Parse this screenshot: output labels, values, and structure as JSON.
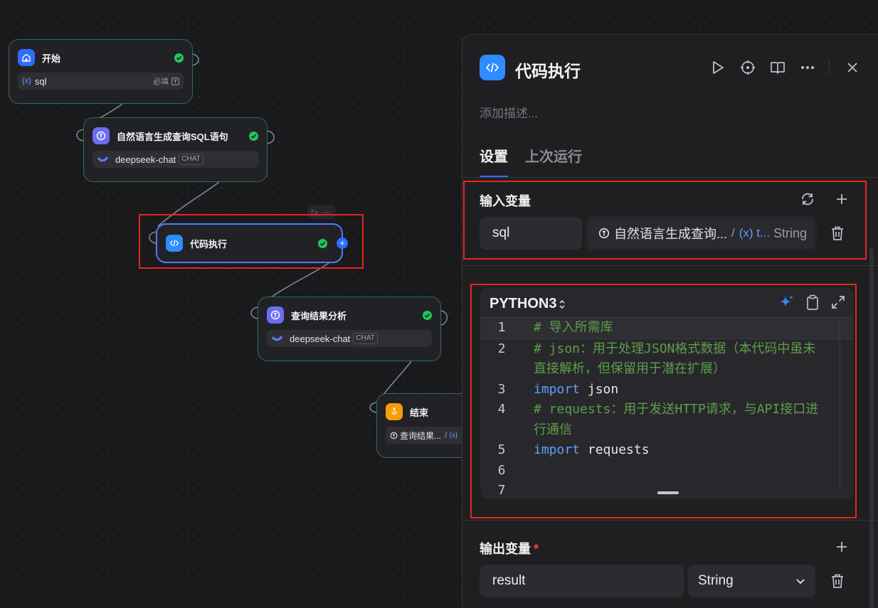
{
  "nodes": {
    "start": {
      "title": "开始",
      "var_icon": "{x}",
      "var_name": "sql",
      "required_label": "必填"
    },
    "nl2sql": {
      "title": "自然语言生成查询SQL语句",
      "model": "deepseek-chat",
      "model_badge": "CHAT"
    },
    "code": {
      "title": "代码执行"
    },
    "analysis": {
      "title": "查询结果分析",
      "model": "deepseek-chat",
      "model_badge": "CHAT"
    },
    "end": {
      "title": "结束",
      "ref_node": "查询结果...",
      "ref_sep": "/",
      "ref_var_icon": "{x}"
    }
  },
  "panel": {
    "title": "代码执行",
    "description_placeholder": "添加描述...",
    "tabs": [
      {
        "label": "设置"
      },
      {
        "label": "上次运行"
      }
    ],
    "input": {
      "title": "输入变量",
      "variables": [
        {
          "name": "sql",
          "ref_node": "自然语言生成查询...",
          "ref_sep": "/",
          "ref_var": "(x) t...",
          "ref_type": "String"
        }
      ]
    },
    "code": {
      "language": "PYTHON3",
      "lines": [
        {
          "no": "1",
          "tokens": [
            {
              "t": "# 导入所需库",
              "k": "comment"
            }
          ]
        },
        {
          "no": "2",
          "tokens": [
            {
              "t": "# json：用于处理JSON格式数据（本代码中虽未直接解析，但保留用于潜在扩展）",
              "k": "comment"
            }
          ]
        },
        {
          "no": "3",
          "tokens": [
            {
              "t": "import",
              "k": "kw"
            },
            {
              "t": " json",
              "k": "txt"
            }
          ]
        },
        {
          "no": "4",
          "tokens": [
            {
              "t": "# requests：用于发送HTTP请求，与API接口进行通信",
              "k": "comment"
            }
          ]
        },
        {
          "no": "5",
          "tokens": [
            {
              "t": "import",
              "k": "kw"
            },
            {
              "t": " requests",
              "k": "txt"
            }
          ]
        },
        {
          "no": "6",
          "tokens": []
        },
        {
          "no": "7",
          "tokens": []
        }
      ]
    },
    "output": {
      "title": "输出变量",
      "required_mark": "*",
      "variables": [
        {
          "name": "result",
          "type": "String"
        }
      ]
    }
  },
  "colors": {
    "accent": "#2f6bff",
    "success": "#22c55e",
    "highlight": "#e5251c",
    "keyword": "#5aa3f5",
    "comment": "#5e9d4b"
  }
}
